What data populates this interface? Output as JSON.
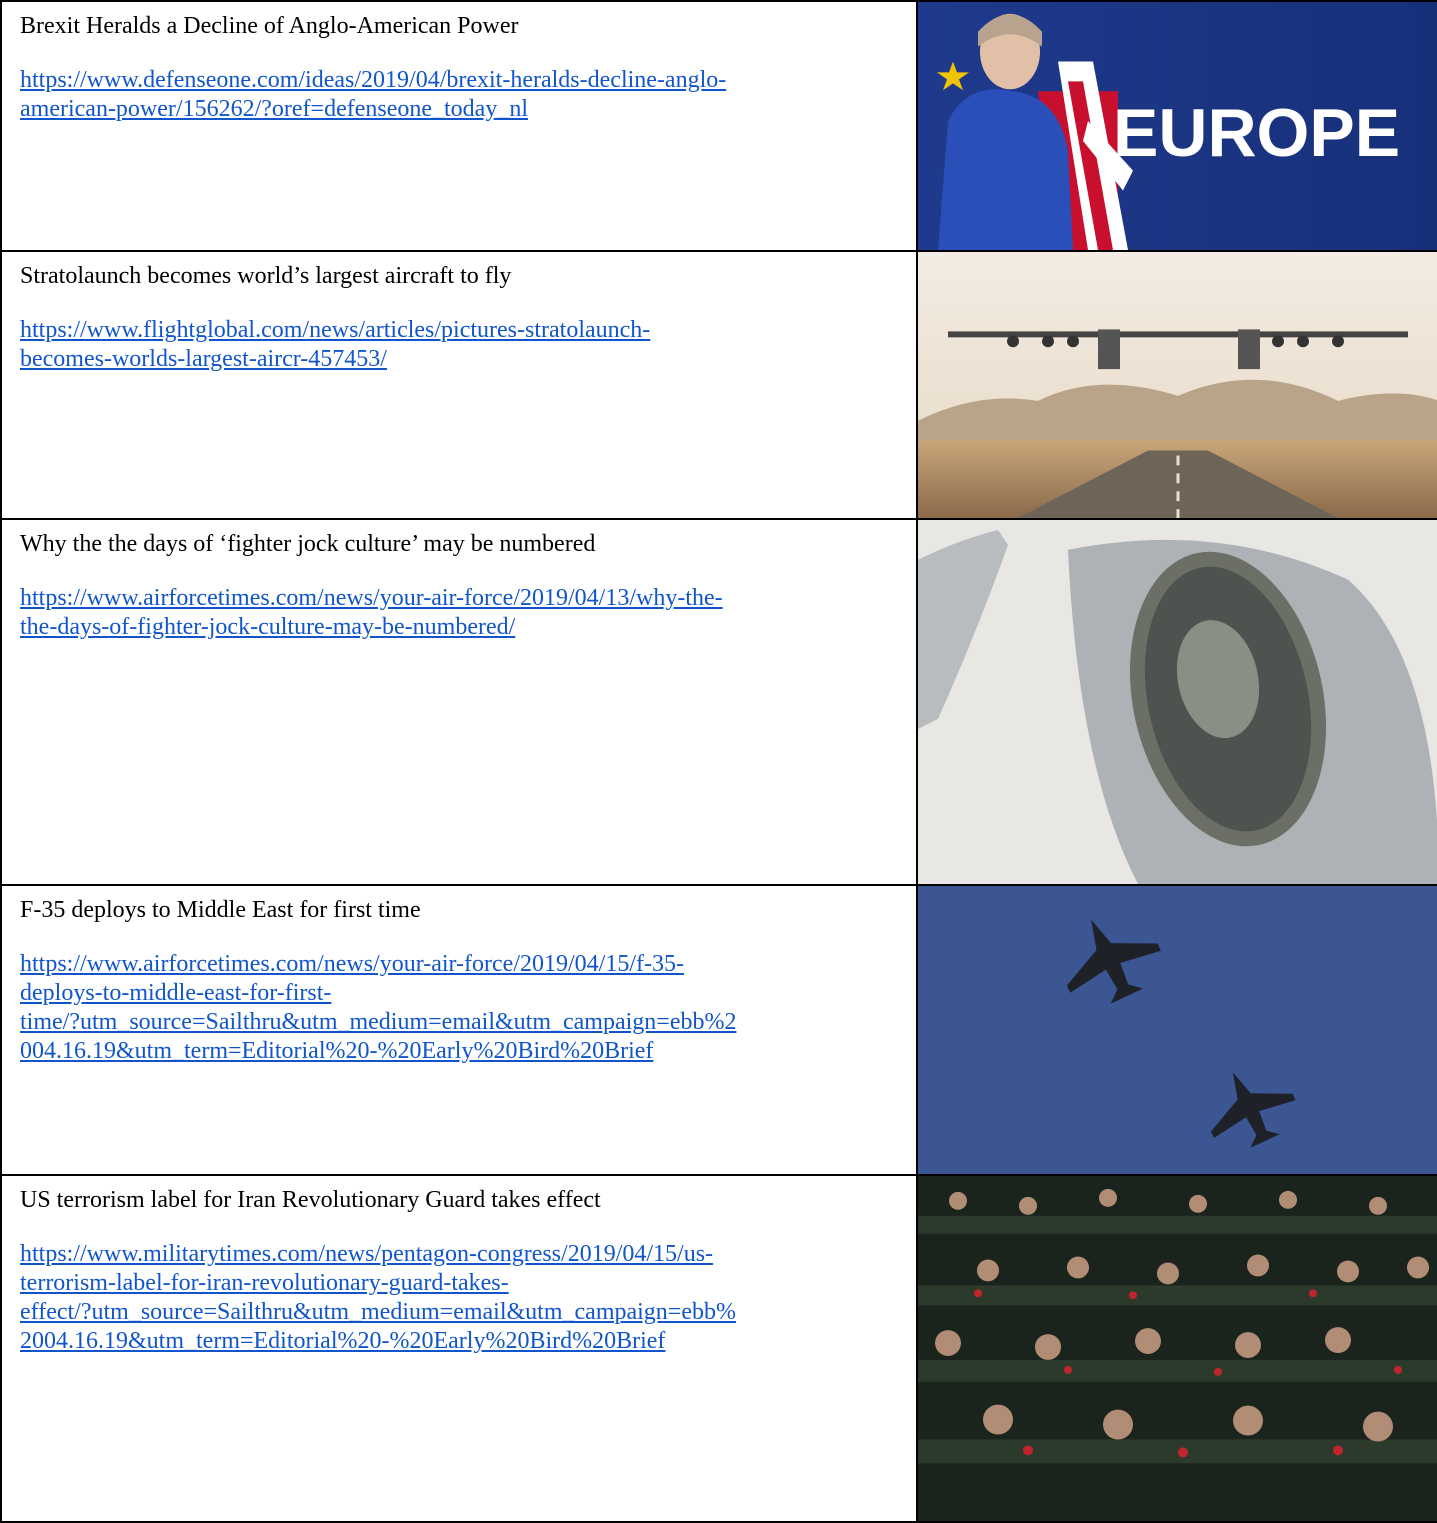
{
  "articles": [
    {
      "headline": "Brexit Heralds a Decline of Anglo-American Power",
      "link_line1": "https://www.defenseone.com/ideas/2019/04/brexit-heralds-decline-anglo-",
      "link_line2": "american-power/156262/?oref=defenseone_today_nl",
      "link_line3": "",
      "link_line4": "",
      "image_alt": "Theresa May in front of a 'EUROPE' sign with EU and UK flags",
      "image_text": "EUROPE"
    },
    {
      "headline": "Stratolaunch becomes world’s largest aircraft to fly",
      "link_line1": "https://www.flightglobal.com/news/articles/pictures-stratolaunch-",
      "link_line2": "becomes-worlds-largest-aircr-457453/",
      "link_line3": "",
      "link_line4": "",
      "image_alt": "Twin-fuselage Stratolaunch aircraft taking off from a desert runway"
    },
    {
      "headline": "Why the the days of ‘fighter jock culture’ may be numbered",
      "link_line1": "https://www.airforcetimes.com/news/your-air-force/2019/04/13/why-the-",
      "link_line2": "the-days-of-fighter-jock-culture-may-be-numbered/",
      "link_line3": "",
      "link_line4": "",
      "image_alt": "Overhead view of a fighter jet cockpit canopy"
    },
    {
      "headline": "F-35 deploys to Middle East for first time",
      "link_line1": "https://www.airforcetimes.com/news/your-air-force/2019/04/15/f-35-",
      "link_line2": "deploys-to-middle-east-for-first-",
      "link_line3": "time/?utm_source=Sailthru&utm_medium=email&utm_campaign=ebb%2",
      "link_line4": "004.16.19&utm_term=Editorial%20-%20Early%20Bird%20Brief",
      "image_alt": "Two F-35 jets flying against a blue sky"
    },
    {
      "headline": "US terrorism label for Iran Revolutionary Guard takes effect",
      "link_line1": "https://www.militarytimes.com/news/pentagon-congress/2019/04/15/us-",
      "link_line2": "terrorism-label-for-iran-revolutionary-guard-takes-",
      "link_line3": "effect/?utm_source=Sailthru&utm_medium=email&utm_campaign=ebb%",
      "link_line4": "2004.16.19&utm_term=Editorial%20-%20Early%20Bird%20Brief",
      "image_alt": "Parliament chamber with members in green uniforms raising fists"
    }
  ],
  "colors": {
    "link": "#1155cc",
    "border": "#000000"
  }
}
